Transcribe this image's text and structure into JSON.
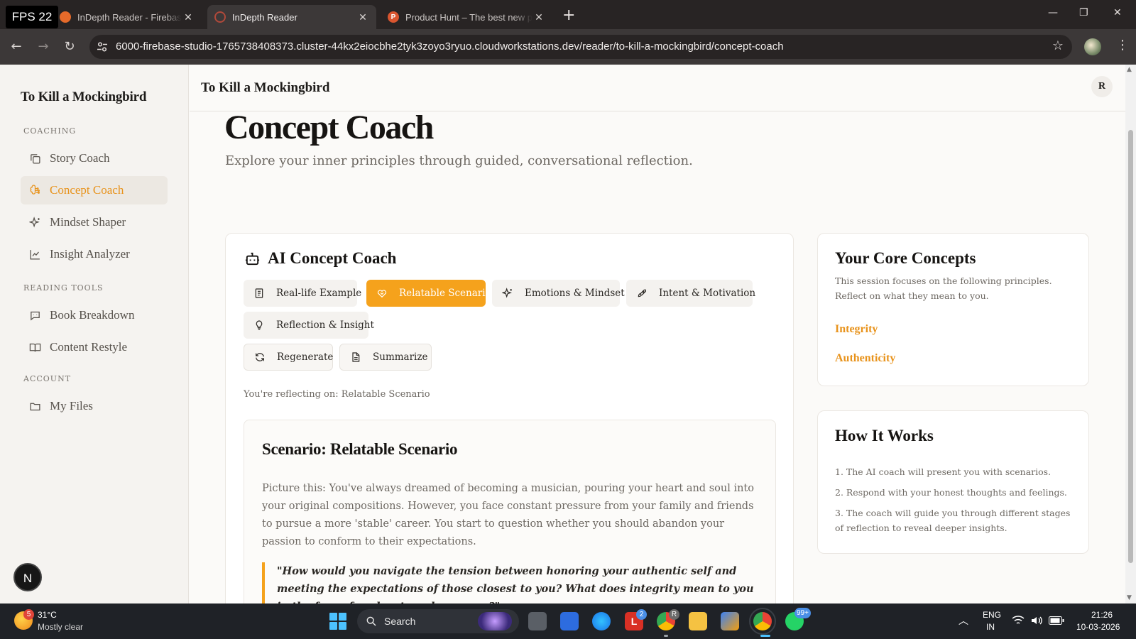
{
  "browser": {
    "fps_label": "FPS 22",
    "tabs": [
      {
        "title": "InDepth Reader - Firebase Studio",
        "fav_color": "#e56a2a"
      },
      {
        "title": "InDepth Reader",
        "fav_color": "#b0493a"
      },
      {
        "title": "Product Hunt – The best new products",
        "fav_color": "#da552f",
        "fav_letter": "P"
      }
    ],
    "new_tab": "+",
    "url": "6000-firebase-studio-1765738408373.cluster-44kx2eiocbhe2tyk3zoyo3ryuo.cloudworkstations.dev/reader/to-kill-a-mockingbird/concept-coach"
  },
  "sidebar": {
    "title": "To Kill a Mockingbird",
    "sections": [
      {
        "label": "COACHING",
        "items": [
          {
            "label": "Story Coach",
            "icon": "copy-icon"
          },
          {
            "label": "Concept Coach",
            "icon": "brain-icon",
            "active": true
          },
          {
            "label": "Mindset Shaper",
            "icon": "sparkles-icon"
          },
          {
            "label": "Insight Analyzer",
            "icon": "chart-line-icon"
          }
        ]
      },
      {
        "label": "READING TOOLS",
        "items": [
          {
            "label": "Book Breakdown",
            "icon": "message-bot-icon"
          },
          {
            "label": "Content Restyle",
            "icon": "book-open-icon"
          }
        ]
      },
      {
        "label": "ACCOUNT",
        "items": [
          {
            "label": "My Files",
            "icon": "folder-icon"
          }
        ]
      }
    ],
    "avatar_letter": "N"
  },
  "header": {
    "book_title": "To Kill a Mockingbird",
    "user_initial": "R"
  },
  "page": {
    "title": "Concept Coach",
    "subtitle": "Explore your inner principles through guided, conversational reflection."
  },
  "coach": {
    "title": "AI Concept Coach",
    "modes": [
      {
        "label": "Real-life Example",
        "icon": "notebook-icon"
      },
      {
        "label": "Relatable Scenario",
        "icon": "heart-handshake-icon",
        "active": true
      },
      {
        "label": "Emotions & Mindset",
        "icon": "sparkles-icon"
      },
      {
        "label": "Intent & Motivation",
        "icon": "rocket-icon"
      },
      {
        "label": "Reflection & Insight",
        "icon": "lightbulb-icon"
      }
    ],
    "actions": [
      {
        "label": "Regenerate",
        "icon": "refresh-icon"
      },
      {
        "label": "Summarize",
        "icon": "file-text-icon"
      }
    ],
    "reflecting_on": "You're reflecting on: Relatable Scenario",
    "scenario": {
      "title": "Scenario: Relatable Scenario",
      "body": "Picture this: You've always dreamed of becoming a musician, pouring your heart and soul into your original compositions. However, you face constant pressure from your family and friends to pursue a more 'stable' career. You start to question whether you should abandon your passion to conform to their expectations.",
      "question": "\"How would you navigate the tension between honoring your authentic self and meeting the expectations of those closest to you? What does integrity mean to you in the face of such external pressure?\""
    }
  },
  "core_concepts": {
    "title": "Your Core Concepts",
    "description": "This session focuses on the following principles. Reflect on what they mean to you.",
    "items": [
      "Integrity",
      "Authenticity"
    ]
  },
  "how_it_works": {
    "title": "How It Works",
    "steps": [
      "1. The AI coach will present you with scenarios.",
      "2. Respond with your honest thoughts and feelings.",
      "3. The coach will guide you through different stages of reflection to reveal deeper insights."
    ]
  },
  "taskbar": {
    "weather_temp": "31°C",
    "weather_desc": "Mostly clear",
    "weather_badge": "5",
    "search_label": "Search",
    "badges": {
      "l_app": "2",
      "chrome_profile": "R",
      "whatsapp": "99+"
    },
    "lang_top": "ENG",
    "lang_bottom": "IN",
    "time": "21:26",
    "date": "10-03-2026"
  },
  "colors": {
    "accent": "#f5a21c",
    "accent_text": "#e8931c",
    "sidebar_bg": "#f5f3f0",
    "browser_bg": "#282424"
  }
}
